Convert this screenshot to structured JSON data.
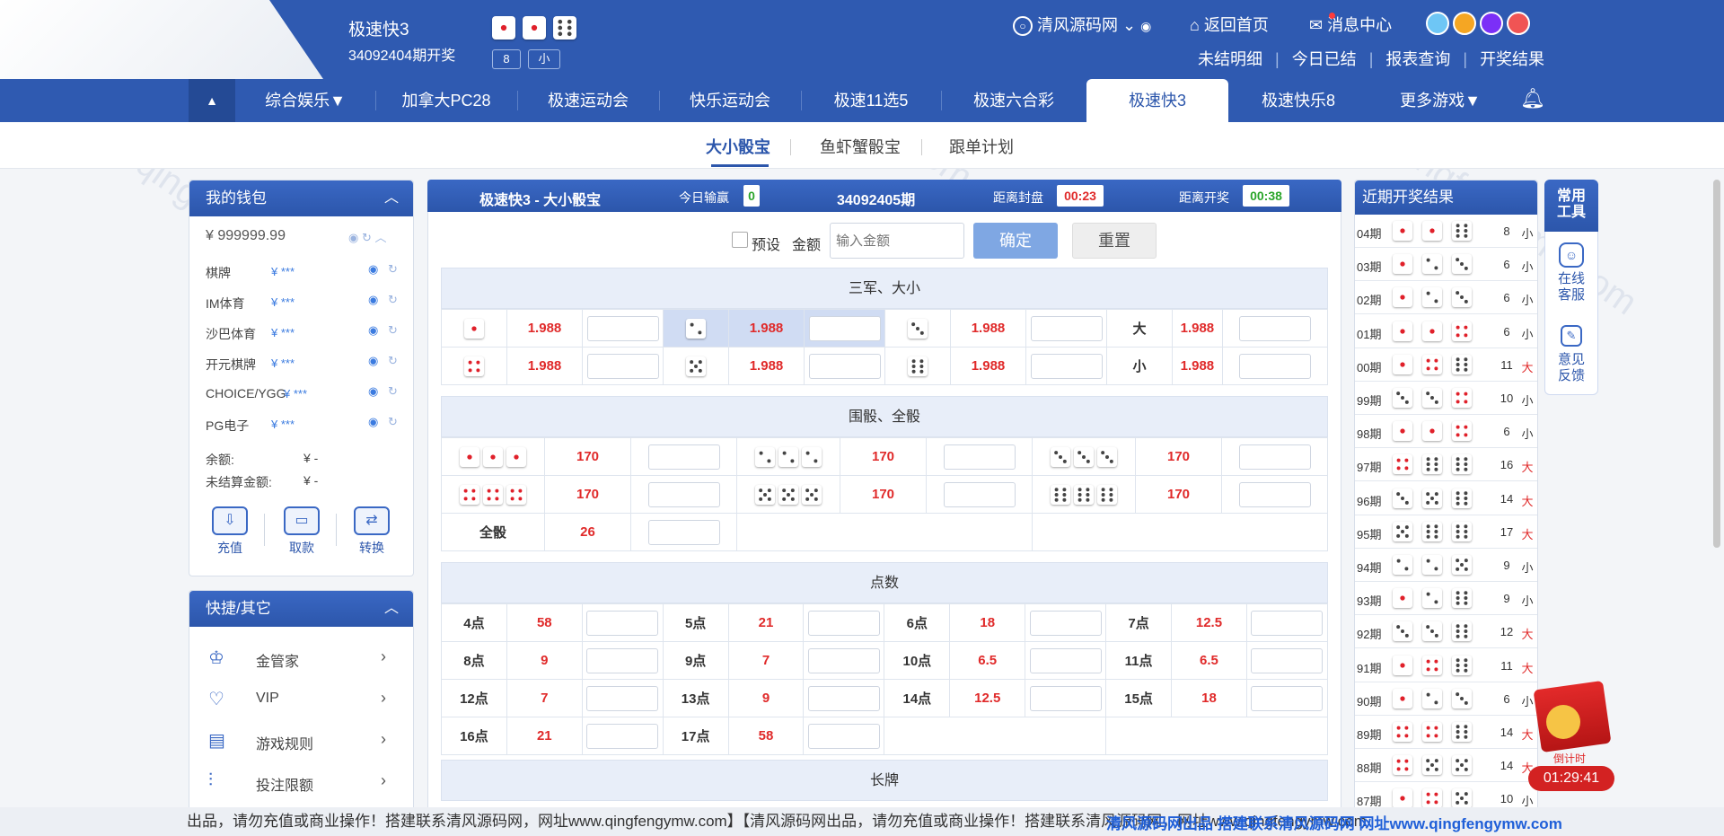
{
  "header": {
    "game_title": "极速快3",
    "period_open": "34092404期开奖",
    "last_dice": [
      "1",
      "1",
      "6"
    ],
    "sum_badge": "8",
    "size_badge": "小",
    "user": "清风源码网",
    "home": "返回首页",
    "messages": "消息中心",
    "links": [
      "未结明细",
      "今日已结",
      "报表查询",
      "开奖结果"
    ],
    "theme_colors": [
      "#6ec6f5",
      "#f5a623",
      "#7b2ff7",
      "#f05454"
    ]
  },
  "nav": {
    "items": [
      "综合娱乐▼",
      "加拿大PC28",
      "极速运动会",
      "快乐运动会",
      "极速11选5",
      "极速六合彩",
      "极速快3",
      "极速快乐8",
      "更多游戏▼"
    ],
    "active": "极速快3"
  },
  "subnav": {
    "items": [
      "大小骰宝",
      "鱼虾蟹骰宝",
      "跟单计划"
    ],
    "active": "大小骰宝"
  },
  "wallet": {
    "title": "我的钱包",
    "balance": "¥ 999999.99",
    "items": [
      {
        "name": "棋牌",
        "value": "¥ ***"
      },
      {
        "name": "IM体育",
        "value": "¥ ***"
      },
      {
        "name": "沙巴体育",
        "value": "¥ ***"
      },
      {
        "name": "开元棋牌",
        "value": "¥ ***"
      },
      {
        "name": "CHOICE/YGG",
        "value": "¥ ***"
      },
      {
        "name": "PG电子",
        "value": "¥ ***"
      }
    ],
    "remain_label": "余额:",
    "remain_value": "¥ -",
    "unsettled_label": "未结算金额:",
    "unsettled_value": "¥ -",
    "actions": [
      "充值",
      "取款",
      "转换"
    ]
  },
  "quick": {
    "title": "快捷/其它",
    "items": [
      "金管家",
      "VIP",
      "游戏规则",
      "投注限额"
    ]
  },
  "bet": {
    "title": "极速快3 - 大小骰宝",
    "today_label": "今日输赢",
    "today_value": "0",
    "period": "34092405期",
    "close_label": "距离封盘",
    "close_time": "00:23",
    "open_label": "距离开奖",
    "open_time": "00:38",
    "preset": "预设",
    "amount_label": "金额",
    "amount_placeholder": "输入金额",
    "confirm": "确定",
    "reset": "重置"
  },
  "sections": {
    "sanjun": "三军、大小",
    "weitou": "围骰、全骰",
    "points": "点数",
    "changpai": "长牌"
  },
  "sanjun": {
    "odds": "1.988",
    "big": "大",
    "small": "小"
  },
  "weitou": {
    "odds": "170",
    "quan_label": "全骰",
    "quan_odds": "26"
  },
  "points": [
    {
      "l": "4点",
      "o": "58"
    },
    {
      "l": "5点",
      "o": "21"
    },
    {
      "l": "6点",
      "o": "18"
    },
    {
      "l": "7点",
      "o": "12.5"
    },
    {
      "l": "8点",
      "o": "9"
    },
    {
      "l": "9点",
      "o": "7"
    },
    {
      "l": "10点",
      "o": "6.5"
    },
    {
      "l": "11点",
      "o": "6.5"
    },
    {
      "l": "12点",
      "o": "7"
    },
    {
      "l": "13点",
      "o": "9"
    },
    {
      "l": "14点",
      "o": "12.5"
    },
    {
      "l": "15点",
      "o": "18"
    },
    {
      "l": "16点",
      "o": "21"
    },
    {
      "l": "17点",
      "o": "58"
    }
  ],
  "results": {
    "title": "近期开奖结果",
    "rows": [
      {
        "p": "04期",
        "d": [
          1,
          1,
          6
        ],
        "s": "8",
        "z": "小"
      },
      {
        "p": "03期",
        "d": [
          1,
          2,
          3
        ],
        "s": "6",
        "z": "小"
      },
      {
        "p": "02期",
        "d": [
          1,
          2,
          3
        ],
        "s": "6",
        "z": "小"
      },
      {
        "p": "01期",
        "d": [
          1,
          1,
          4
        ],
        "s": "6",
        "z": "小"
      },
      {
        "p": "00期",
        "d": [
          1,
          4,
          6
        ],
        "s": "11",
        "z": "大"
      },
      {
        "p": "99期",
        "d": [
          3,
          3,
          4
        ],
        "s": "10",
        "z": "小"
      },
      {
        "p": "98期",
        "d": [
          1,
          1,
          4
        ],
        "s": "6",
        "z": "小"
      },
      {
        "p": "97期",
        "d": [
          4,
          6,
          6
        ],
        "s": "16",
        "z": "大"
      },
      {
        "p": "96期",
        "d": [
          3,
          5,
          6
        ],
        "s": "14",
        "z": "大"
      },
      {
        "p": "95期",
        "d": [
          5,
          6,
          6
        ],
        "s": "17",
        "z": "大"
      },
      {
        "p": "94期",
        "d": [
          2,
          2,
          5
        ],
        "s": "9",
        "z": "小"
      },
      {
        "p": "93期",
        "d": [
          1,
          2,
          6
        ],
        "s": "9",
        "z": "小"
      },
      {
        "p": "92期",
        "d": [
          3,
          3,
          6
        ],
        "s": "12",
        "z": "大"
      },
      {
        "p": "91期",
        "d": [
          1,
          4,
          6
        ],
        "s": "11",
        "z": "大"
      },
      {
        "p": "90期",
        "d": [
          1,
          2,
          3
        ],
        "s": "6",
        "z": "小"
      },
      {
        "p": "89期",
        "d": [
          4,
          4,
          6
        ],
        "s": "14",
        "z": "大"
      },
      {
        "p": "88期",
        "d": [
          4,
          5,
          5
        ],
        "s": "14",
        "z": "大"
      },
      {
        "p": "87期",
        "d": [
          1,
          4,
          5
        ],
        "s": "10",
        "z": "小"
      }
    ]
  },
  "tools": {
    "title": "常用工具",
    "service": "在线客服",
    "feedback": "意见反馈"
  },
  "redpacket": {
    "label": "倒计时",
    "time": "01:29:41"
  },
  "ticker": "出品，请勿充值或商业操作！搭建联系清风源码网，网址www.qingfengymw.com】【清风源码网出品，请勿充值或商业操作！搭建联系清风源码网，网址www.qingfengymw.com",
  "ticker_overlay": "清风源码网出品 搭建联系清风源码网 网址www.qingfengymw.com",
  "watermark": "www.qingfengymw.com"
}
